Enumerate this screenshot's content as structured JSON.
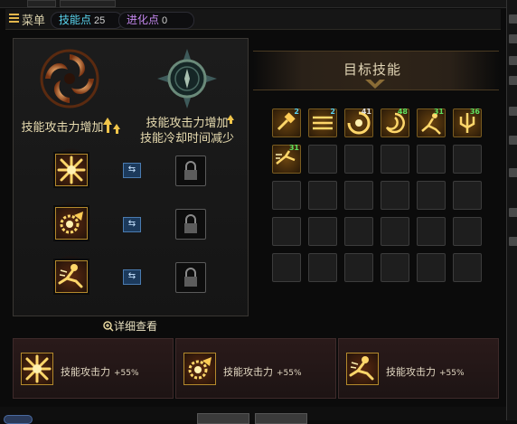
{
  "header": {
    "menu_label": "菜单",
    "skill_points": {
      "label": "技能点",
      "value": "25"
    },
    "evo_points": {
      "label": "进化点",
      "value": "0"
    }
  },
  "left_panel": {
    "left_option": {
      "label": "技能攻击力增加"
    },
    "right_option": {
      "label_line1": "技能攻击力增加",
      "label_line2": "技能冷却时间减少"
    },
    "rows": [
      {
        "left_icon": "starburst-skill-icon",
        "right": "locked"
      },
      {
        "left_icon": "gear-fist-skill-icon",
        "right": "locked"
      },
      {
        "left_icon": "kick-skill-icon",
        "right": "locked"
      }
    ],
    "detail_link": "详细查看"
  },
  "right_panel": {
    "title": "目标技能",
    "skills": [
      {
        "icon": "hammer-strike-icon",
        "level": "2",
        "level_color": "#5ad0f0"
      },
      {
        "icon": "triple-slash-icon",
        "level": "2",
        "level_color": "#5ad0f0"
      },
      {
        "icon": "spin-slash-icon",
        "level": "41",
        "level_color": "#e0e0e0"
      },
      {
        "icon": "vortex-icon",
        "level": "48",
        "level_color": "#5fe05f"
      },
      {
        "icon": "leap-attack-icon",
        "level": "31",
        "level_color": "#5fe05f"
      },
      {
        "icon": "trident-burst-icon",
        "level": "36",
        "level_color": "#5fe05f"
      },
      {
        "icon": "dash-kick-icon",
        "level": "31",
        "level_color": "#5fe05f"
      }
    ],
    "empty_slots": 23
  },
  "bottom_cards": [
    {
      "icon": "starburst-skill-icon",
      "label": "技能攻击力",
      "value": "+55%"
    },
    {
      "icon": "gear-fist-skill-icon",
      "label": "技能攻击力",
      "value": "+55%"
    },
    {
      "icon": "kick-skill-icon",
      "label": "技能攻击力",
      "value": "+55%"
    }
  ],
  "colors": {
    "accent_gold": "#e2b64c",
    "skill_point_cyan": "#59d4ee",
    "evo_point_purple": "#c488ee"
  }
}
